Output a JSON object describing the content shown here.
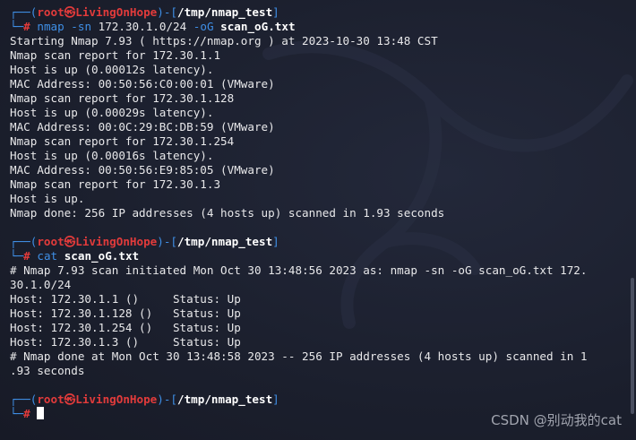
{
  "prompt": {
    "corner_top": "┌──(",
    "user_host": "root㉿LivingOnHope",
    "path_open": ")-[",
    "path_close": "]",
    "corner_bottom": "└─",
    "hash": "#"
  },
  "blocks": [
    {
      "path": "/tmp/nmap_test",
      "command_parts": [
        "nmap",
        " -sn ",
        "172.30.1.0/24",
        " -oG ",
        "scan_oG.txt"
      ],
      "output": [
        "Starting Nmap 7.93 ( https://nmap.org ) at 2023-10-30 13:48 CST",
        "Nmap scan report for 172.30.1.1",
        "Host is up (0.00012s latency).",
        "MAC Address: 00:50:56:C0:00:01 (VMware)",
        "Nmap scan report for 172.30.1.128",
        "Host is up (0.00029s latency).",
        "MAC Address: 00:0C:29:BC:DB:59 (VMware)",
        "Nmap scan report for 172.30.1.254",
        "Host is up (0.00016s latency).",
        "MAC Address: 00:50:56:E9:85:05 (VMware)",
        "Nmap scan report for 172.30.1.3",
        "Host is up.",
        "Nmap done: 256 IP addresses (4 hosts up) scanned in 1.93 seconds"
      ]
    },
    {
      "path": "/tmp/nmap_test",
      "command_parts": [
        "cat",
        " ",
        "scan_oG.txt"
      ],
      "output": [
        "# Nmap 7.93 scan initiated Mon Oct 30 13:48:56 2023 as: nmap -sn -oG scan_oG.txt 172.",
        "30.1.0/24",
        "Host: 172.30.1.1 ()     Status: Up",
        "Host: 172.30.1.128 ()   Status: Up",
        "Host: 172.30.1.254 ()   Status: Up",
        "Host: 172.30.1.3 ()     Status: Up",
        "# Nmap done at Mon Oct 30 13:48:58 2023 -- 256 IP addresses (4 hosts up) scanned in 1",
        ".93 seconds"
      ]
    },
    {
      "path": "/tmp/nmap_test"
    }
  ],
  "watermark": "CSDN @别动我的cat",
  "colors": {
    "background": "#1c2030",
    "prompt_blue": "#3f8fe6",
    "prompt_red": "#e23b3b",
    "text": "#e8e8ea"
  }
}
